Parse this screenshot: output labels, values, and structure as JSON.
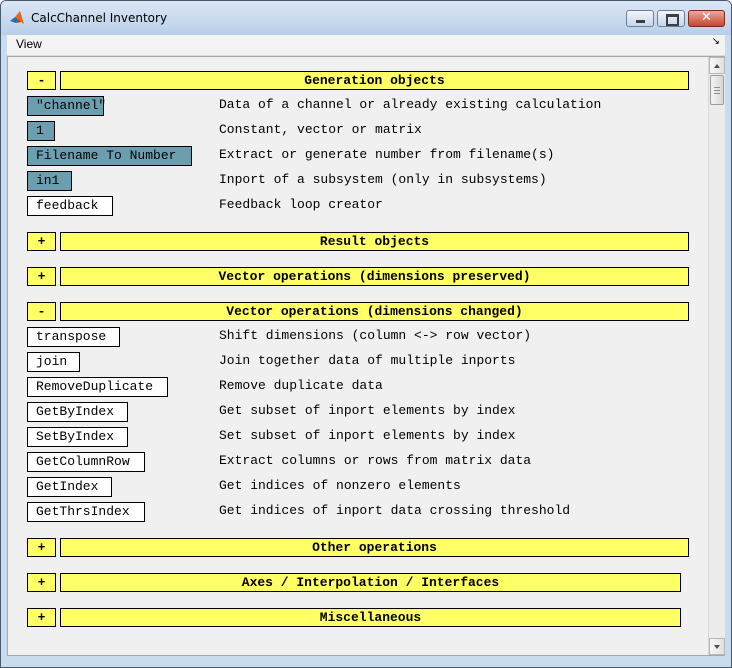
{
  "window": {
    "title": "CalcChannel Inventory"
  },
  "titlebar_buttons": {
    "close_label": "✕"
  },
  "menu": {
    "view_label": "View",
    "corner_glyph": "↘"
  },
  "colors": {
    "header_fill": "#ffff66",
    "block_fill_blue": "#6b9fb0",
    "block_fill_white": "#ffffff"
  },
  "sections": [
    {
      "toggle": "-",
      "title": "Generation objects",
      "items": [
        {
          "block": "\"channel\"",
          "desc": "Data of a channel or already existing calculation",
          "style": "blue"
        },
        {
          "block": "1",
          "desc": "Constant, vector or matrix",
          "style": "blue"
        },
        {
          "block": "Filename To Number",
          "desc": "Extract or generate number from filename(s)",
          "style": "blue"
        },
        {
          "block": "in1",
          "desc": "Inport of a subsystem (only in subsystems)",
          "style": "blue"
        },
        {
          "block": "feedback",
          "desc": "Feedback loop creator",
          "style": "white"
        }
      ]
    },
    {
      "toggle": "+",
      "title": "Result objects",
      "items": []
    },
    {
      "toggle": "+",
      "title": "Vector operations (dimensions preserved)",
      "items": []
    },
    {
      "toggle": "-",
      "title": "Vector operations (dimensions changed)",
      "items": [
        {
          "block": "transpose",
          "desc": "Shift dimensions (column <-> row vector)",
          "style": "white"
        },
        {
          "block": "join",
          "desc": "Join together data of multiple inports",
          "style": "white"
        },
        {
          "block": "RemoveDuplicate",
          "desc": "Remove duplicate data",
          "style": "white"
        },
        {
          "block": "GetByIndex",
          "desc": "Get subset of inport elements by index",
          "style": "white"
        },
        {
          "block": "SetByIndex",
          "desc": "Set subset of inport elements by index",
          "style": "white"
        },
        {
          "block": "GetColumnRow",
          "desc": "Extract columns or rows from matrix data",
          "style": "white"
        },
        {
          "block": "GetIndex",
          "desc": "Get indices of nonzero elements",
          "style": "white"
        },
        {
          "block": "GetThrsIndex",
          "desc": "Get indices of inport data crossing threshold",
          "style": "white"
        }
      ]
    },
    {
      "toggle": "+",
      "title": "Other operations",
      "items": []
    },
    {
      "toggle": "+",
      "title": "Axes / Interpolation / Interfaces",
      "items": []
    },
    {
      "toggle": "+",
      "title": "Miscellaneous",
      "items": []
    }
  ]
}
